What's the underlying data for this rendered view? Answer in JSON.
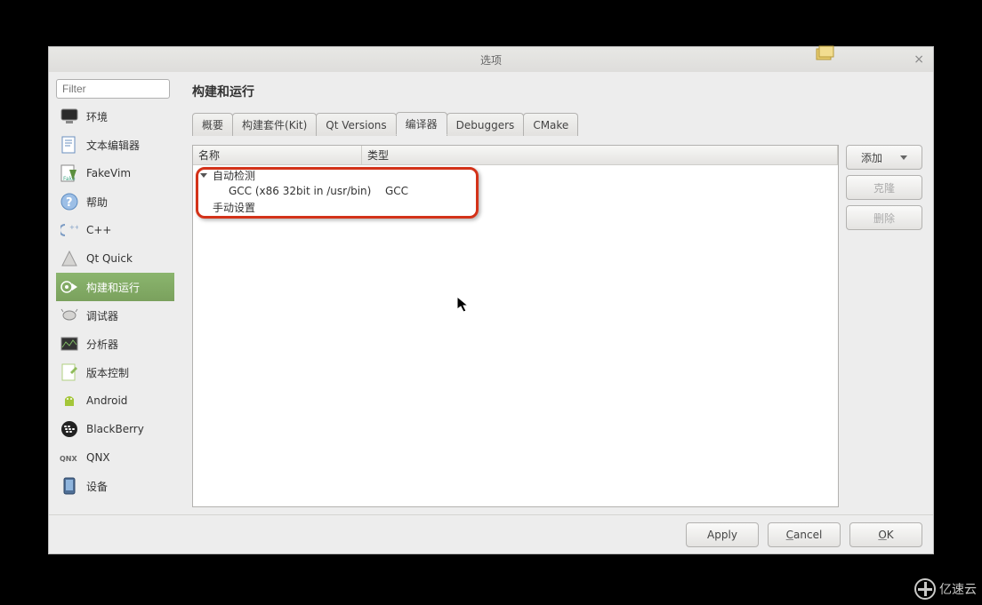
{
  "window": {
    "title": "选项"
  },
  "filter": {
    "placeholder": "Filter"
  },
  "sidebar": {
    "items": [
      {
        "label": "环境",
        "icon": "monitor"
      },
      {
        "label": "文本编辑器",
        "icon": "text-edit"
      },
      {
        "label": "FakeVim",
        "icon": "fakevim"
      },
      {
        "label": "帮助",
        "icon": "help"
      },
      {
        "label": "C++",
        "icon": "cpp"
      },
      {
        "label": "Qt Quick",
        "icon": "qtquick"
      },
      {
        "label": "构建和运行",
        "icon": "build-run",
        "selected": true
      },
      {
        "label": "调试器",
        "icon": "debugger"
      },
      {
        "label": "分析器",
        "icon": "analyzer"
      },
      {
        "label": "版本控制",
        "icon": "vcs"
      },
      {
        "label": "Android",
        "icon": "android"
      },
      {
        "label": "BlackBerry",
        "icon": "blackberry"
      },
      {
        "label": "QNX",
        "icon": "qnx"
      },
      {
        "label": "设备",
        "icon": "device"
      }
    ]
  },
  "page": {
    "title": "构建和运行",
    "tabs": [
      "概要",
      "构建套件(Kit)",
      "Qt Versions",
      "编译器",
      "Debuggers",
      "CMake"
    ],
    "active_tab": "编译器"
  },
  "table": {
    "headers": {
      "name": "名称",
      "type": "类型"
    },
    "groups": [
      {
        "label": "自动检测",
        "items": [
          {
            "name": "GCC (x86 32bit in /usr/bin)",
            "type": "GCC"
          }
        ]
      },
      {
        "label": "手动设置",
        "items": []
      }
    ]
  },
  "buttons": {
    "add": "添加",
    "clone": "克隆",
    "remove": "删除",
    "apply": "Apply",
    "cancel": "Cancel",
    "ok": "OK"
  },
  "watermark": "亿速云"
}
